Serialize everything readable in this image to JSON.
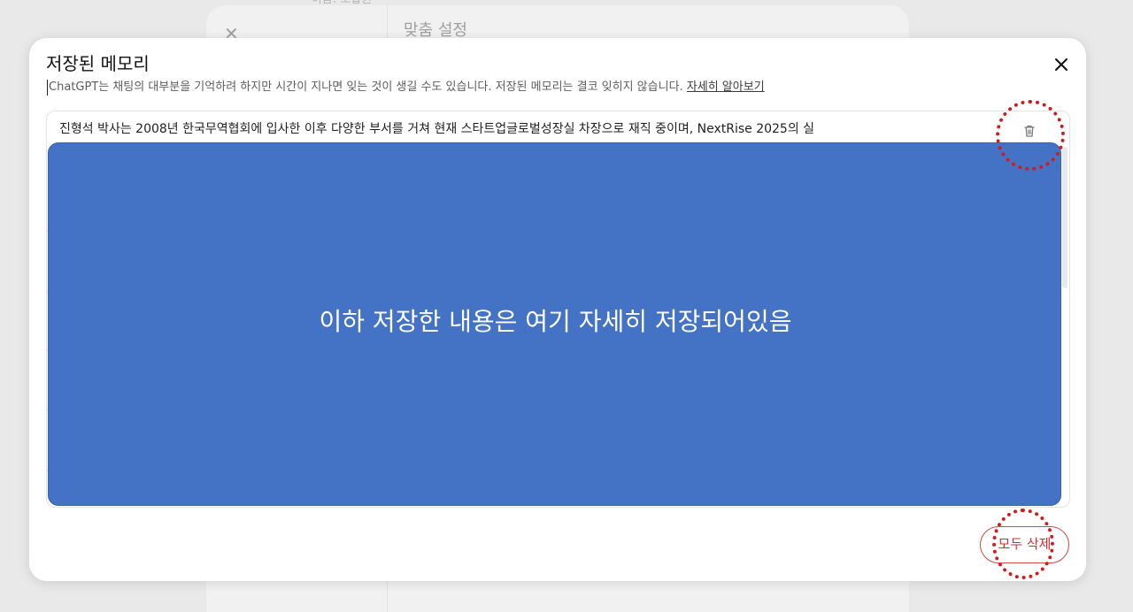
{
  "background": {
    "top_text": "• 이름: 조합원",
    "close_glyph": "✕",
    "title": "맞춤 설정"
  },
  "modal": {
    "title": "저장된 메모리",
    "description": "ChatGPT는 채팅의 대부분을 기억하려 하지만 시간이 지나면 잊는 것이 생길 수도 있습니다. 저장된 메모리는 결코 잊히지 않습니다.",
    "learn_more": "자세히 알아보기",
    "memories": [
      {
        "text": "진형석 박사는 2008년 한국무역협회에 입사한 이후 다양한 부서를 거쳐 현재 스타트업글로벌성장실 차장으로 재직 중이며, NextRise 2025의 실"
      }
    ],
    "redaction_text": "이하 저장한 내용은 여기 자세히 저장되어있음",
    "delete_all_label": "모두 삭제"
  },
  "colors": {
    "redaction": "#4472c4",
    "annotation": "#d11b1b",
    "danger": "#d03030"
  }
}
